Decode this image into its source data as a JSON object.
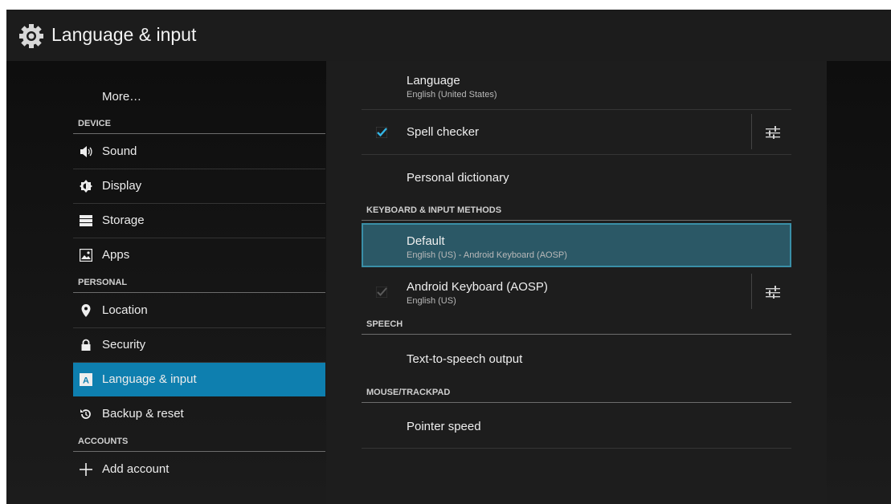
{
  "actionbar": {
    "title": "Language & input",
    "icon": "gear-icon"
  },
  "left": {
    "more": "More…",
    "categories": {
      "device": "DEVICE",
      "personal": "PERSONAL",
      "accounts": "ACCOUNTS"
    },
    "items": {
      "sound": "Sound",
      "display": "Display",
      "storage": "Storage",
      "apps": "Apps",
      "location": "Location",
      "security": "Security",
      "language": "Language & input",
      "backup": "Backup & reset",
      "add_account": "Add account"
    }
  },
  "right": {
    "language": {
      "title": "Language",
      "summary": "English (United States)"
    },
    "spell_checker": {
      "title": "Spell checker",
      "checked": true
    },
    "personal_dictionary": {
      "title": "Personal dictionary"
    },
    "cat_keyboard": "KEYBOARD & INPUT METHODS",
    "default": {
      "title": "Default",
      "summary": "English (US) - Android Keyboard (AOSP)"
    },
    "aosp": {
      "title": "Android Keyboard (AOSP)",
      "summary": "English (US)",
      "checked": true
    },
    "cat_speech": "SPEECH",
    "tts": {
      "title": "Text-to-speech output"
    },
    "cat_mouse": "MOUSE/TRACKPAD",
    "pointer": {
      "title": "Pointer speed"
    }
  },
  "colors": {
    "accent": "#0e7faf",
    "focus_bg": "#2b5866",
    "check": "#33b5e5"
  }
}
